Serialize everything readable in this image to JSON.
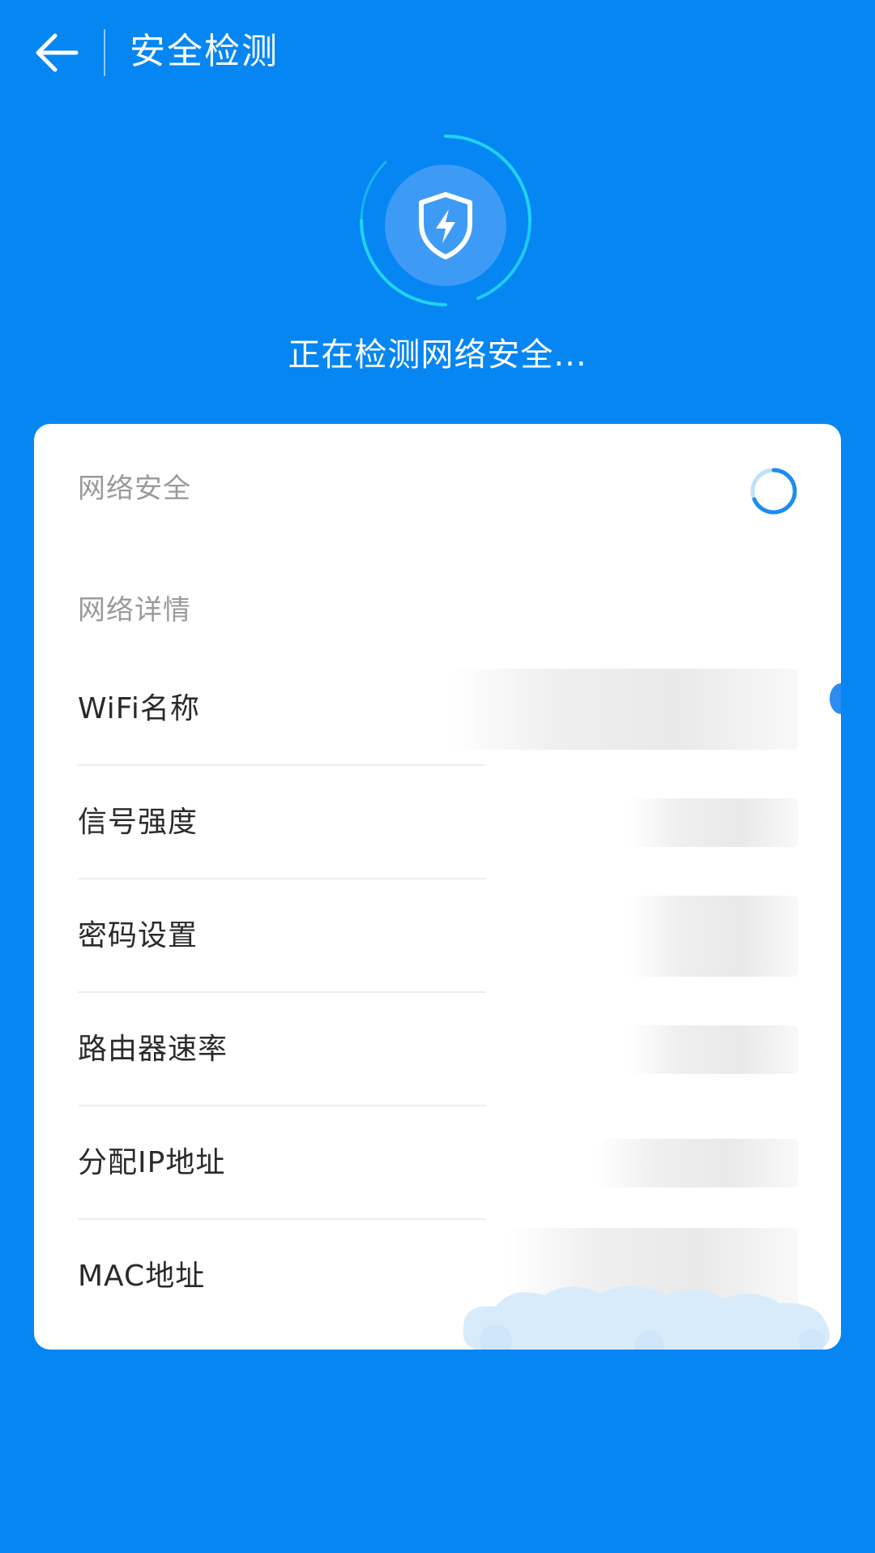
{
  "header": {
    "title": "安全检测",
    "back_icon": "arrow-left-icon"
  },
  "scan": {
    "icon": "shield-lightning-icon",
    "status": "正在检测网络安全..."
  },
  "card": {
    "security_section": {
      "label": "网络安全",
      "status_icon": "loading-spinner-icon"
    },
    "details_section": {
      "label": "网络详情",
      "rows": [
        {
          "label": "WiFi名称"
        },
        {
          "label": "信号强度"
        },
        {
          "label": "密码设置"
        },
        {
          "label": "路由器速率"
        },
        {
          "label": "分配IP地址"
        },
        {
          "label": "MAC地址"
        }
      ]
    }
  },
  "colors": {
    "background": "#0686F2",
    "card": "#FFFFFF",
    "accent": "#1FD3F4",
    "shield_circle": "#3E9BF5"
  }
}
